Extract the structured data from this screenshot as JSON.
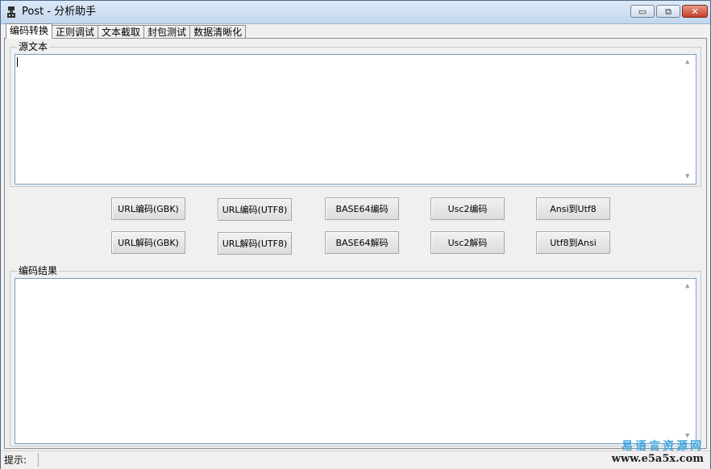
{
  "window": {
    "title": "Post - 分析助手",
    "controls": {
      "minimize": "▭",
      "maximize": "⧉",
      "close": "✕"
    }
  },
  "tabs": [
    {
      "label": "编码转换",
      "active": true
    },
    {
      "label": "正则调试",
      "active": false
    },
    {
      "label": "文本截取",
      "active": false
    },
    {
      "label": "封包测试",
      "active": false
    },
    {
      "label": "数据清晰化",
      "active": false
    }
  ],
  "source": {
    "label": "源文本",
    "value": ""
  },
  "result": {
    "label": "编码结果",
    "value": ""
  },
  "buttons": {
    "url_encode_gbk": "URL编码(GBK)",
    "url_encode_utf8": "URL编码(UTF8)",
    "base64_encode": "BASE64编码",
    "usc2_encode": "Usc2编码",
    "ansi_to_utf8": "Ansi到Utf8",
    "url_decode_gbk": "URL解码(GBK)",
    "url_decode_utf8": "URL解码(UTF8)",
    "base64_decode": "BASE64解码",
    "usc2_decode": "Usc2解码",
    "utf8_to_ansi": "Utf8到Ansi"
  },
  "statusbar": {
    "label": "提示:",
    "text": ""
  },
  "watermark": {
    "cn": "易语言资源网",
    "en": "www.e5a5x.com"
  },
  "scroll_icons": {
    "up": "▲",
    "down": "▼"
  },
  "colors": {
    "titlebar": "#c3d7ee",
    "close_button": "#c63c28",
    "textarea_border": "#7a9cc2",
    "watermark_cn": "#3fa7e0"
  }
}
